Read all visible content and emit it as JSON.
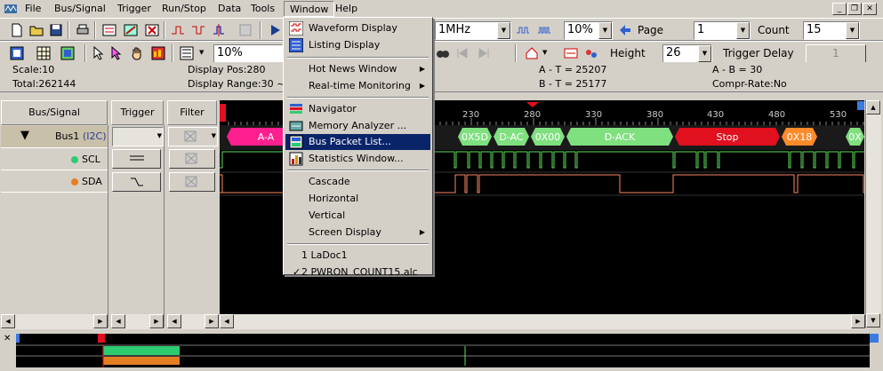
{
  "menubar": {
    "items": [
      "File",
      "Bus/Signal",
      "Trigger",
      "Run/Stop",
      "Data",
      "Tools",
      "Window",
      "Help"
    ]
  },
  "toolbar1": {
    "freq": "1MHz",
    "zoom": "10%",
    "page_label": "Page",
    "page_value": "1",
    "count_label": "Count",
    "count_value": "15"
  },
  "toolbar2": {
    "zoom": "10%",
    "height_label": "Height",
    "height_value": "26",
    "trigger_delay_label": "Trigger Delay",
    "trigger_delay_value": "1"
  },
  "info": {
    "scale": "Scale:10",
    "total": "Total:262144",
    "display_pos": "Display Pos:280",
    "display_range": "Display Range:30 ~ 5",
    "a_t": "A - T = 25207",
    "b_t": "B - T = 25177",
    "a_b": "A - B = 30",
    "compr": "Compr-Rate:No"
  },
  "columns": {
    "bus_signal": "Bus/Signal",
    "trigger": "Trigger",
    "filter": "Filter"
  },
  "signals": {
    "bus_name": "Bus1",
    "bus_type": "(I2C)",
    "scl": "SCL",
    "sda": "SDA"
  },
  "ruler": {
    "ticks": [
      "230",
      "280",
      "330",
      "380",
      "430",
      "480",
      "530"
    ]
  },
  "packets": [
    {
      "label": "A-A",
      "color": "#ff1f8f"
    },
    {
      "label": "0X5D",
      "color": "#7fe07f"
    },
    {
      "label": "D-AC",
      "color": "#7fe07f"
    },
    {
      "label": "0X00",
      "color": "#7fe07f"
    },
    {
      "label": "D-ACK",
      "color": "#7fe07f"
    },
    {
      "label": "Stop",
      "color": "#e0101e"
    },
    {
      "label": "0X18",
      "color": "#ff8a2a"
    },
    {
      "label": "0X",
      "color": "#7fe07f"
    }
  ],
  "window_menu": {
    "items": [
      {
        "label": "Waveform Display",
        "icon": "waveform-icon"
      },
      {
        "label": "Listing Display",
        "icon": "listing-icon"
      },
      {
        "label": "Hot News Window",
        "submenu": true
      },
      {
        "label": "Real-time Monitoring",
        "submenu": true
      },
      {
        "label": "Navigator",
        "icon": "navigator-icon"
      },
      {
        "label": "Memory Analyzer ...",
        "icon": "memory-icon"
      },
      {
        "label": "Bus Packet List...",
        "icon": "bus-packet-icon",
        "highlighted": true
      },
      {
        "label": "Statistics Window...",
        "icon": "statistics-icon"
      },
      {
        "label": "Cascade"
      },
      {
        "label": "Horizontal"
      },
      {
        "label": "Vertical"
      },
      {
        "label": "Screen Display",
        "submenu": true
      },
      {
        "label": "1 LaDoc1"
      },
      {
        "label": "2 PWRON_COUNT15.alc",
        "checked": true
      }
    ]
  },
  "colors": {
    "highlight": "#0a246a",
    "scl_dot": "#2ecc71",
    "sda_dot": "#e67e22",
    "scl_wave": "#5ee05e",
    "sda_wave": "#ff8866"
  }
}
